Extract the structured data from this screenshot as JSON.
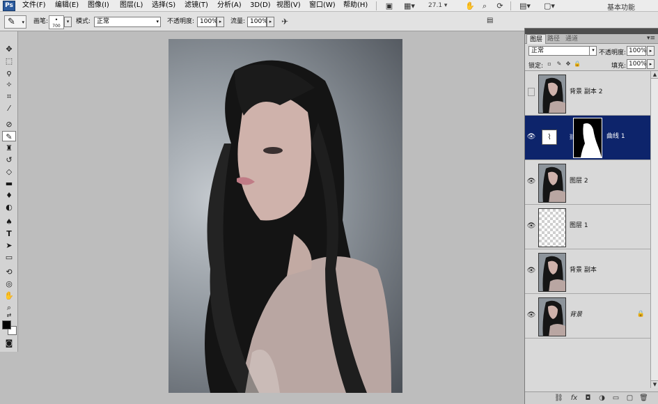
{
  "app": {
    "logo": "Ps"
  },
  "menubar": {
    "items": [
      "文件(F)",
      "编辑(E)",
      "图像(I)",
      "图层(L)",
      "选择(S)",
      "滤镜(T)",
      "分析(A)",
      "3D(D)",
      "视图(V)",
      "窗口(W)",
      "帮助(H)"
    ],
    "icons": [
      "bridge-icon",
      "view-extras-icon",
      "zoom-level-icon",
      "hand-tool-icon",
      "zoom-tool-icon",
      "rotate-view-icon",
      "arrange-documents-icon",
      "screen-mode-icon"
    ],
    "zoom_value": "27.1",
    "workspace_label": "基本功能"
  },
  "options_bar": {
    "brush_label": "画笔:",
    "brush_size": "700",
    "mode_label": "模式:",
    "mode_value": "正常",
    "opacity_label": "不透明度:",
    "opacity_value": "100%",
    "flow_label": "流量:",
    "flow_value": "100%",
    "icons": [
      "brush-preset-icon",
      "airbrush-icon",
      "palette-toggle-icon"
    ]
  },
  "toolbox": {
    "tools": [
      "move-tool-icon",
      "marquee-tool-icon",
      "lasso-tool-icon",
      "quick-selection-tool-icon",
      "crop-tool-icon",
      "eyedropper-tool-icon",
      "spot-healing-tool-icon",
      "brush-tool-icon",
      "clone-stamp-tool-icon",
      "history-brush-tool-icon",
      "eraser-tool-icon",
      "gradient-tool-icon",
      "blur-tool-icon",
      "dodge-tool-icon",
      "pen-tool-icon",
      "type-tool-icon",
      "path-selection-tool-icon",
      "shape-tool-icon",
      "3d-rotate-tool-icon",
      "3d-orbit-tool-icon",
      "hand-tool-icon",
      "zoom-tool-icon"
    ],
    "selected_tool": "brush-tool-icon",
    "foreground_color": "#000000",
    "background_color": "#ffffff"
  },
  "layers_panel": {
    "tabs": [
      "图层",
      "路径",
      "通道"
    ],
    "active_tab": "图层",
    "blend_mode": "正常",
    "opacity_label": "不透明度:",
    "opacity_value": "100%",
    "lock_label": "锁定:",
    "fill_label": "填充:",
    "fill_value": "100%",
    "layers": [
      {
        "name": "背景 副本 2",
        "visible": false,
        "selected": false,
        "type": "image"
      },
      {
        "name": "曲线 1",
        "visible": true,
        "selected": true,
        "type": "curves-adjustment-with-mask"
      },
      {
        "name": "图层 2",
        "visible": true,
        "selected": false,
        "type": "image"
      },
      {
        "name": "图层 1",
        "visible": true,
        "selected": false,
        "type": "transparent"
      },
      {
        "name": "背景 副本",
        "visible": true,
        "selected": false,
        "type": "image"
      },
      {
        "name": "背景",
        "visible": true,
        "selected": false,
        "type": "image-locked"
      }
    ],
    "footer_icons": [
      "link-layers-icon",
      "layer-style-icon",
      "add-mask-icon",
      "new-adjustment-icon",
      "new-group-icon",
      "new-layer-icon",
      "delete-layer-icon"
    ],
    "selection_color": "#0d246b"
  }
}
